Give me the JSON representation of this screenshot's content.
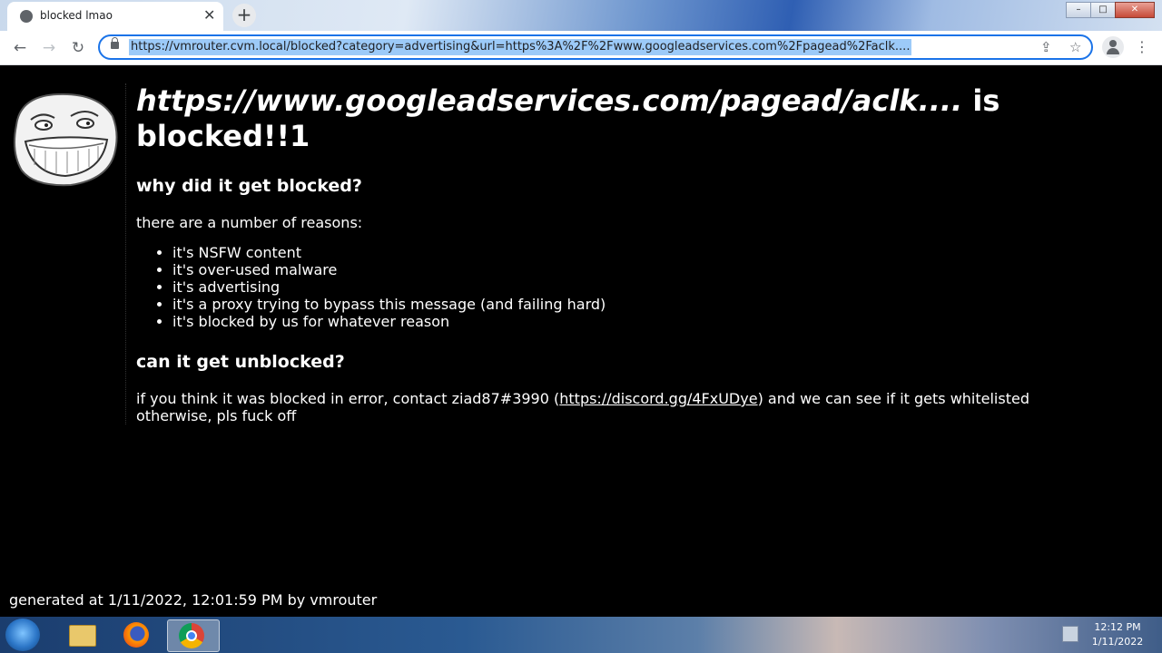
{
  "browser": {
    "tab_title": "blocked lmao",
    "tab_close": "✕",
    "new_tab": "+",
    "url": "https://vmrouter.cvm.local/blocked?category=advertising&url=https%3A%2F%2Fwww.googleadservices.com%2Fpagead%2Faclk....",
    "back_icon": "←",
    "forward_icon": "→",
    "reload_icon": "↻",
    "share_icon": "⇪",
    "star_icon": "☆",
    "menu_icon": "⋮",
    "min_label": "–",
    "max_label": "□",
    "close_label": "✕"
  },
  "page": {
    "blocked_url": "https://www.googleadservices.com/pagead/aclk....",
    "headline_rest": " is blocked!!1",
    "why_heading": "why did it get blocked?",
    "reasons_intro": "there are a number of reasons:",
    "reasons": [
      "it's NSFW content",
      "it's over-used malware",
      "it's advertising",
      "it's a proxy trying to bypass this message (and failing hard)",
      "it's blocked by us for whatever reason"
    ],
    "unblock_heading": "can it get unblocked?",
    "contact_prefix": "if you think it was blocked in error, contact ziad87#3990 (",
    "contact_link": "https://discord.gg/4FxUDye",
    "contact_suffix": ") and we can see if it gets whitelisted",
    "contact_line2": "otherwise, pls fuck off",
    "footer": "generated at 1/11/2022, 12:01:59 PM by vmrouter"
  },
  "taskbar": {
    "time": "12:12 PM",
    "date": "1/11/2022",
    "icons": [
      "start-orb",
      "file-explorer",
      "firefox",
      "chrome"
    ]
  }
}
